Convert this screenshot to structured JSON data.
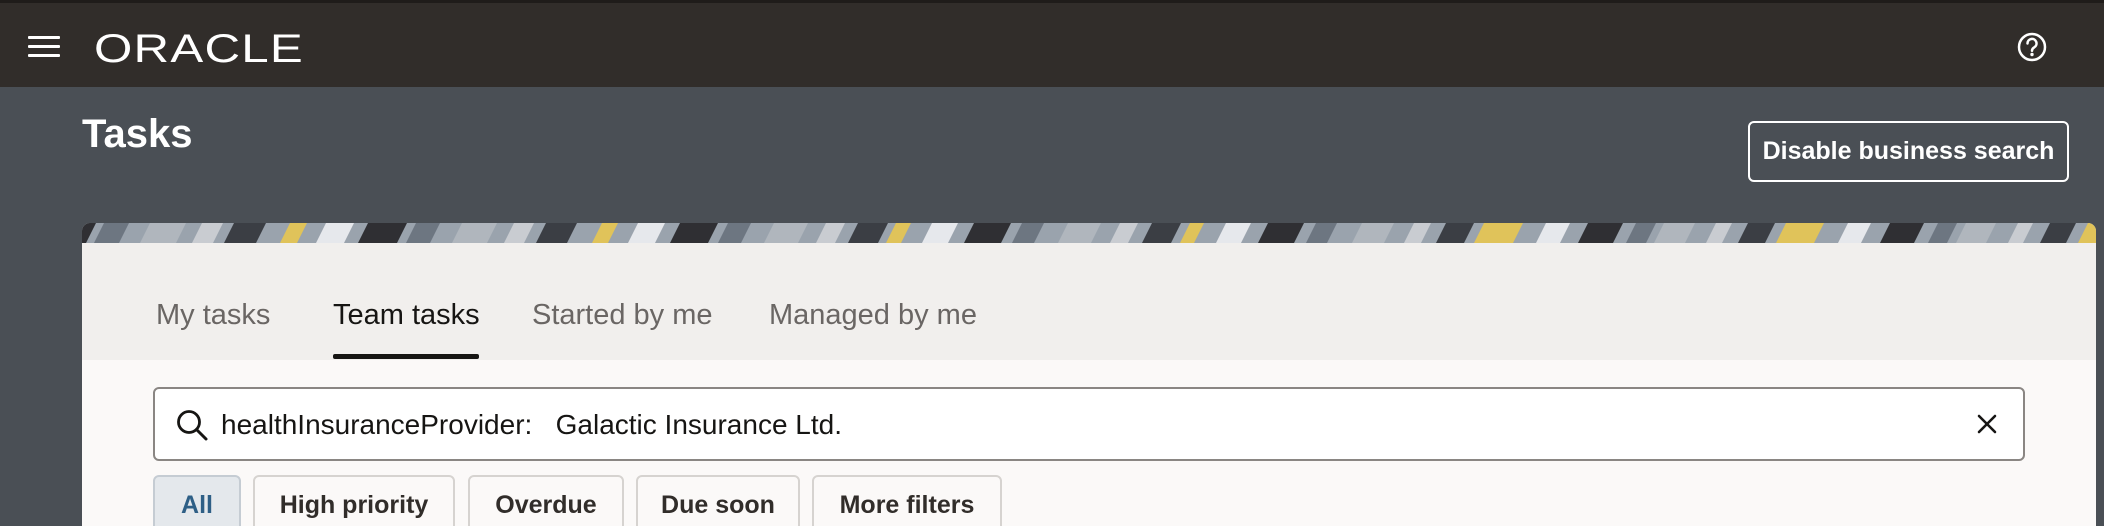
{
  "header": {
    "brand": "ORACLE",
    "menu_icon": "hamburger-menu-icon",
    "help_icon": "help-icon"
  },
  "page": {
    "title": "Tasks",
    "disable_search_label": "Disable business search"
  },
  "tabs": [
    {
      "label": "My tasks",
      "active": false
    },
    {
      "label": "Team tasks",
      "active": true
    },
    {
      "label": "Started by me",
      "active": false
    },
    {
      "label": "Managed by me",
      "active": false
    }
  ],
  "search": {
    "value": "healthInsuranceProvider:   Galactic Insurance Ltd.",
    "search_icon": "search-icon",
    "clear_icon": "close-icon"
  },
  "filters": [
    {
      "label": "All",
      "selected": true
    },
    {
      "label": "High priority",
      "selected": false
    },
    {
      "label": "Overdue",
      "selected": false
    },
    {
      "label": "Due soon",
      "selected": false
    },
    {
      "label": "More filters",
      "selected": false
    }
  ],
  "colors": {
    "topbar": "#312d2a",
    "page_background": "#4a4f55",
    "selected_chip_text": "#2e5f86"
  }
}
